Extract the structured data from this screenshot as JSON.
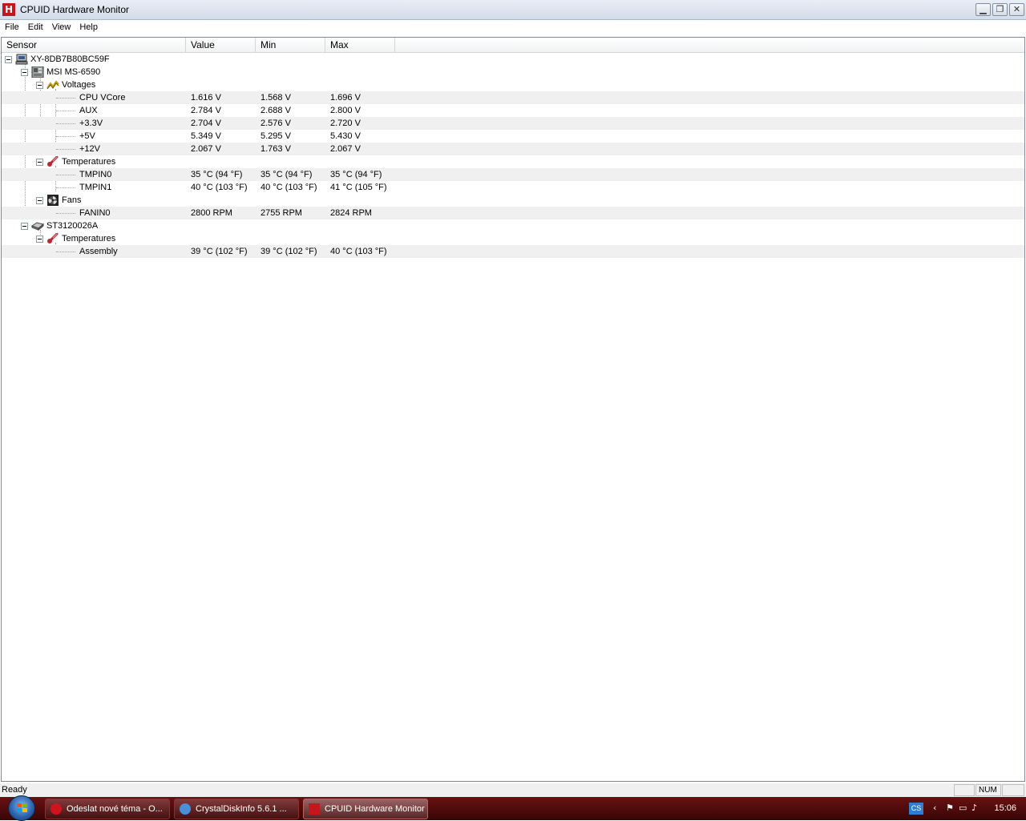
{
  "window": {
    "title": "CPUID Hardware Monitor",
    "app_icon_letter": "H"
  },
  "menu": [
    "File",
    "Edit",
    "View",
    "Help"
  ],
  "columns": {
    "sensor": "Sensor",
    "value": "Value",
    "min": "Min",
    "max": "Max"
  },
  "tree": {
    "computer": "XY-8DB7B80BC59F",
    "board": "MSI MS-6590",
    "voltages_group": "Voltages",
    "voltages": [
      {
        "name": "CPU VCore",
        "value": "1.616 V",
        "min": "1.568 V",
        "max": "1.696 V"
      },
      {
        "name": "AUX",
        "value": "2.784 V",
        "min": "2.688 V",
        "max": "2.800 V"
      },
      {
        "name": "+3.3V",
        "value": "2.704 V",
        "min": "2.576 V",
        "max": "2.720 V"
      },
      {
        "name": "+5V",
        "value": "5.349 V",
        "min": "5.295 V",
        "max": "5.430 V"
      },
      {
        "name": "+12V",
        "value": "2.067 V",
        "min": "1.763 V",
        "max": "2.067 V"
      }
    ],
    "temps_group": "Temperatures",
    "temps": [
      {
        "name": "TMPIN0",
        "value": "35 °C  (94 °F)",
        "min": "35 °C  (94 °F)",
        "max": "35 °C  (94 °F)"
      },
      {
        "name": "TMPIN1",
        "value": "40 °C  (103 °F)",
        "min": "40 °C  (103 °F)",
        "max": "41 °C  (105 °F)"
      }
    ],
    "fans_group": "Fans",
    "fans": [
      {
        "name": "FANIN0",
        "value": "2800 RPM",
        "min": "2755 RPM",
        "max": "2824 RPM"
      }
    ],
    "disk": "ST3120026A",
    "disk_temps_group": "Temperatures",
    "disk_temps": [
      {
        "name": "Assembly",
        "value": "39 °C  (102 °F)",
        "min": "39 °C  (102 °F)",
        "max": "40 °C  (103 °F)"
      }
    ]
  },
  "status": {
    "text": "Ready",
    "num": "NUM"
  },
  "taskbar": {
    "tasks": [
      {
        "label": "Odeslat nové téma - O...",
        "icon_color": "#d0141e"
      },
      {
        "label": "CrystalDiskInfo 5.6.1 ...",
        "icon_color": "#4a90d9"
      },
      {
        "label": "CPUID Hardware Monitor",
        "icon_color": "#c4161c"
      }
    ],
    "language": "CS",
    "clock": "15:06"
  }
}
